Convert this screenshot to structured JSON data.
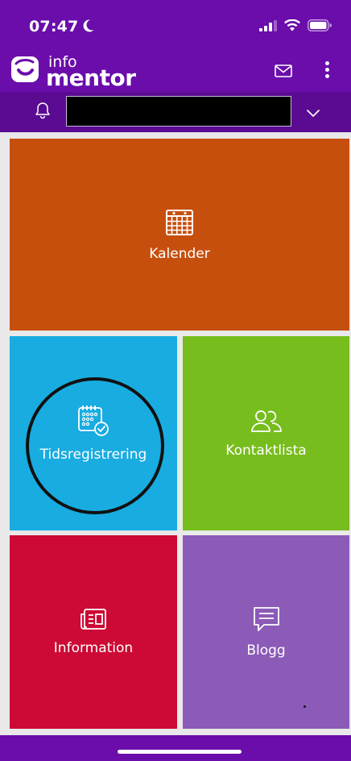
{
  "status": {
    "time": "07:47",
    "icons": [
      "moon-icon",
      "signal-icon",
      "wifi-icon",
      "battery-icon"
    ]
  },
  "app": {
    "logo_top": "info",
    "logo_bottom": "mentor",
    "icons": [
      "mail-icon",
      "more-vertical-icon"
    ]
  },
  "pupil_bar": {
    "icons": [
      "bell-icon",
      "chevron-down-icon"
    ],
    "selected_pupil": ""
  },
  "tiles": [
    {
      "label": "Kalender",
      "icon": "calendar-icon",
      "color": "#c74f0e"
    },
    {
      "label": "Tidsregistrering",
      "icon": "time-registration-icon",
      "color": "#18ace1"
    },
    {
      "label": "Kontaktlista",
      "icon": "contacts-icon",
      "color": "#77bd1d"
    },
    {
      "label": "Information",
      "icon": "newspaper-icon",
      "color": "#cc0a35"
    },
    {
      "label": "Blogg",
      "icon": "chat-bubble-icon",
      "color": "#8b5bb7"
    }
  ],
  "colors": {
    "header": "#6a0dab",
    "pupil_bar": "#5a0b92",
    "background": "#e9e9e9"
  }
}
